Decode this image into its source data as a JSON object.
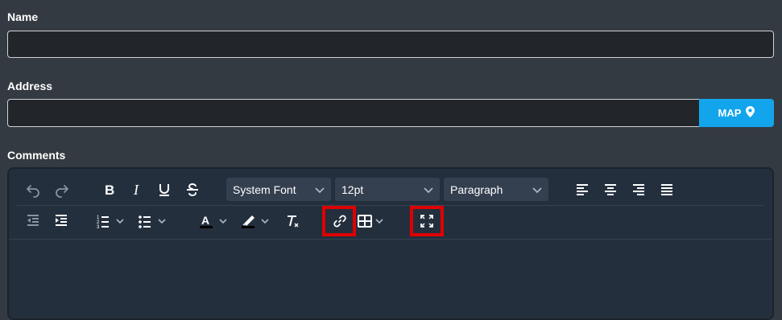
{
  "form": {
    "name_label": "Name",
    "name_value": "",
    "address_label": "Address",
    "address_value": "",
    "map_button": "MAP",
    "comments_label": "Comments"
  },
  "editor": {
    "font_family": "System Font",
    "font_size": "12pt",
    "block_format": "Paragraph",
    "icons": [
      "undo-icon",
      "redo-icon",
      "bold-icon",
      "italic-icon",
      "underline-icon",
      "strikethrough-icon",
      "align-left-icon",
      "align-center-icon",
      "align-right-icon",
      "align-justify-icon",
      "outdent-icon",
      "indent-icon",
      "numbered-list-icon",
      "bullet-list-icon",
      "text-color-icon",
      "highlight-color-icon",
      "clear-formatting-icon",
      "link-icon",
      "table-icon",
      "fullscreen-icon"
    ],
    "highlighted": [
      "link-icon",
      "fullscreen-icon"
    ],
    "body_text": ""
  },
  "colors": {
    "background": "#343a41",
    "map_button": "#12a5ec",
    "editor_bg": "#242f3e",
    "highlight": "#e00000"
  }
}
